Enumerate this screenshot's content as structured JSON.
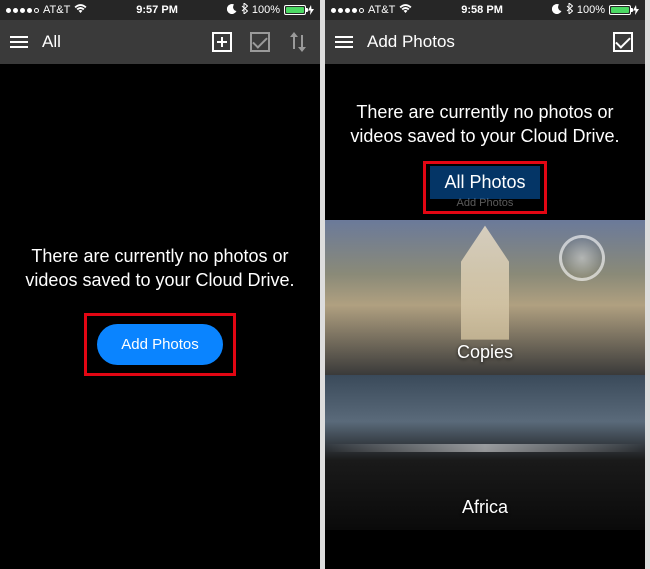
{
  "left": {
    "status": {
      "carrier": "AT&T",
      "time": "9:57 PM",
      "battery": "100%"
    },
    "nav": {
      "title": "All"
    },
    "empty": {
      "line1": "There are currently no photos or",
      "line2": "videos saved to your Cloud Drive."
    },
    "cta": {
      "label": "Add Photos"
    }
  },
  "right": {
    "status": {
      "carrier": "AT&T",
      "time": "9:58 PM",
      "battery": "100%"
    },
    "nav": {
      "title": "Add Photos"
    },
    "empty": {
      "line1": "There are currently no photos or",
      "line2": "videos saved to your Cloud Drive."
    },
    "selector": {
      "label": "All Photos",
      "sub": "Add Photos"
    },
    "albums": [
      {
        "name": "Copies"
      },
      {
        "name": "Africa"
      }
    ]
  }
}
